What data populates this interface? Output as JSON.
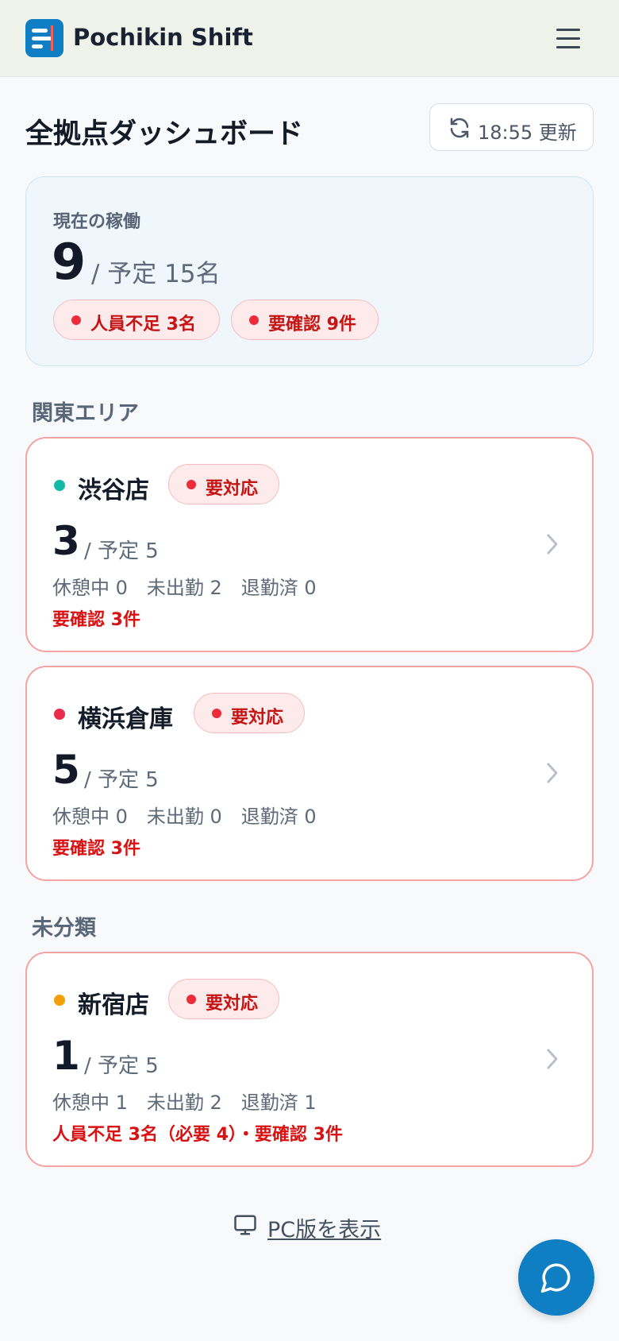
{
  "header": {
    "app_name": "Pochikin Shift",
    "logo_icon": "pochikin-logo-icon",
    "menu_icon": "hamburger-menu-icon"
  },
  "page": {
    "title": "全拠点ダッシュボード",
    "refresh_label": "18:55 更新",
    "refresh_icon": "refresh-icon"
  },
  "summary": {
    "label": "現在の稼働",
    "current": "9",
    "planned": "/ 予定 15名",
    "pills": [
      {
        "label": "人員不足 3名"
      },
      {
        "label": "要確認 9件"
      }
    ]
  },
  "sections": [
    {
      "title": "関東エリア",
      "sites": [
        {
          "name": "渋谷店",
          "status_color": "#14b8a6",
          "badge": "要対応",
          "count": "3",
          "planned": "/ 予定 5",
          "breakdown": "休憩中 0　未出勤 2　退勤済 0",
          "alert": "要確認 3件"
        },
        {
          "name": "横浜倉庫",
          "status_color": "#ec2a4c",
          "badge": "要対応",
          "count": "5",
          "planned": "/ 予定 5",
          "breakdown": "休憩中 0　未出勤 0　退勤済 0",
          "alert": "要確認 3件"
        }
      ]
    },
    {
      "title": "未分類",
      "sites": [
        {
          "name": "新宿店",
          "status_color": "#f59e0b",
          "badge": "要対応",
          "count": "1",
          "planned": "/ 予定 5",
          "breakdown": "休憩中 1　未出勤 2　退勤済 1",
          "alert": "人員不足 3名（必要 4）・要確認 3件"
        }
      ]
    }
  ],
  "footer": {
    "pc_link": "PC版を表示",
    "pc_icon": "monitor-icon",
    "chat_icon": "chat-bubble-icon"
  },
  "colors": {
    "brand": "#0f7ec2",
    "alert": "#d81212",
    "card_border": "#f4a3a3"
  }
}
